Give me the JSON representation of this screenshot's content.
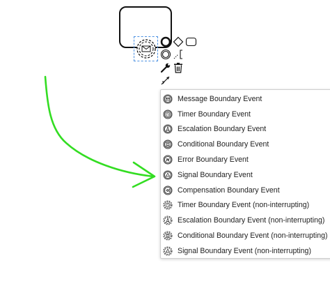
{
  "popup_menu": {
    "entries": [
      {
        "label": "Message Boundary Event",
        "icon": "message-event-icon"
      },
      {
        "label": "Timer Boundary Event",
        "icon": "timer-event-icon"
      },
      {
        "label": "Escalation Boundary Event",
        "icon": "escalation-event-icon"
      },
      {
        "label": "Conditional Boundary Event",
        "icon": "conditional-event-icon"
      },
      {
        "label": "Error Boundary Event",
        "icon": "error-event-icon"
      },
      {
        "label": "Signal Boundary Event",
        "icon": "signal-event-icon"
      },
      {
        "label": "Compensation Boundary Event",
        "icon": "compensation-event-icon"
      },
      {
        "label": "Timer Boundary Event (non-interrupting)",
        "icon": "timer-event-non-interrupting-icon"
      },
      {
        "label": "Escalation Boundary Event (non-interrupting)",
        "icon": "escalation-event-non-interrupting-icon"
      },
      {
        "label": "Conditional Boundary Event (non-interrupting)",
        "icon": "conditional-event-non-interrupting-icon"
      },
      {
        "label": "Signal Boundary Event (non-interrupting)",
        "icon": "signal-event-non-interrupting-icon"
      }
    ]
  },
  "context_pad": {
    "icons": [
      "end-event-icon",
      "gateway-icon",
      "task-icon",
      "intermediate-event-icon",
      "text-annotation-icon",
      "wrench-icon",
      "trash-icon",
      "connect-icon"
    ]
  },
  "colors": {
    "annotation_arrow": "#33dd22",
    "selection": "#4a90e2",
    "stroke": "#111111"
  }
}
